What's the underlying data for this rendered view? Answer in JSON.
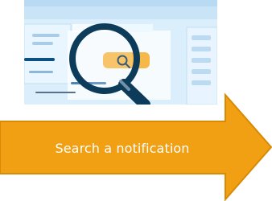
{
  "illustration": {
    "subject": "search magnifying glass over webpage",
    "icon": "search-icon",
    "colors": {
      "background": "#dbeefb",
      "search_box_accent": "#f7b84a",
      "lens_ring": "#0d3b5a"
    }
  },
  "cta": {
    "label": "Search a notification",
    "icon": "arrow-right-icon",
    "colors": {
      "fill": "#f0a012",
      "stroke": "#d88a06",
      "text": "#ffffff"
    }
  }
}
